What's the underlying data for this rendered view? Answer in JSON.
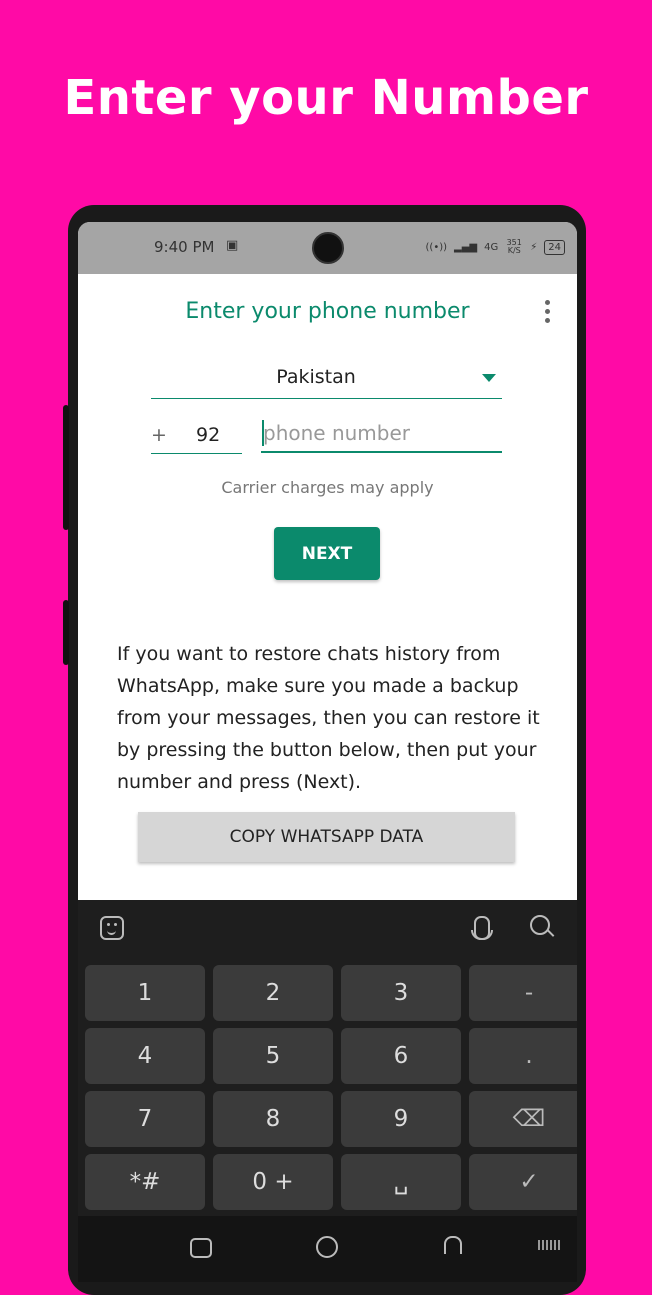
{
  "headline": "Enter your Number",
  "status_bar": {
    "time": "9:40 PM",
    "sim_icon": "sim-icon",
    "hotspot_icon": "hotspot-icon",
    "network_1": "4G",
    "speed": "351 K/S",
    "battery": "24"
  },
  "app": {
    "title": "Enter your phone number",
    "menu_icon": "more-vert-icon",
    "country": "Pakistan",
    "plus": "+",
    "country_code": "92",
    "phone_placeholder": "phone number",
    "carrier_note": "Carrier charges may apply",
    "next_label": "NEXT",
    "info_text": "If you want to restore chats history from WhatsApp, make sure you made a backup from your messages, then you can restore it by pressing the button below, then put your number and press (Next).",
    "copy_label": "COPY WHATSAPP DATA",
    "accent_color": "#0b8a6c"
  },
  "keyboard": {
    "keys": [
      [
        "1",
        "2",
        "3",
        "-"
      ],
      [
        "4",
        "5",
        "6",
        "."
      ],
      [
        "7",
        "8",
        "9",
        "⌫"
      ],
      [
        "*#",
        "0 +",
        "␣",
        "✓"
      ]
    ]
  },
  "background_color": "#ff0aa6"
}
